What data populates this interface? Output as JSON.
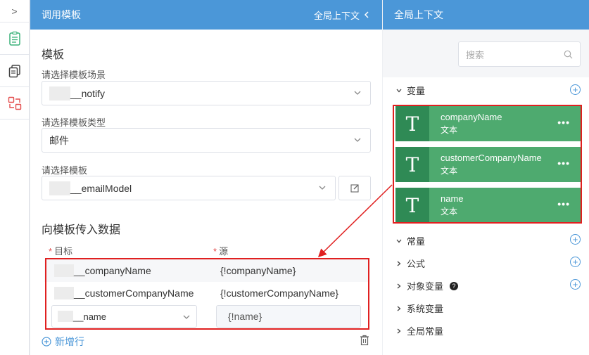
{
  "rail": {
    "toggle": ">"
  },
  "middle": {
    "header_title": "调用模板",
    "header_ctx": "全局上下文",
    "section_template": "模板",
    "scene": {
      "label": "请选择模板场景",
      "value": "__notify"
    },
    "type": {
      "label": "请选择模板类型",
      "value": "邮件"
    },
    "template": {
      "label": "请选择模板",
      "value": "__emailModel"
    },
    "section_pass": "向模板传入数据",
    "col_target": "目标",
    "col_source": "源",
    "required_mark": "*",
    "rows": [
      {
        "target": "__companyName",
        "source": "{!companyName}"
      },
      {
        "target": "__customerCompanyName",
        "source": "{!customerCompanyName}"
      },
      {
        "target": "__name",
        "source": "{!name}"
      }
    ],
    "add_row": "新增行"
  },
  "right": {
    "header_title": "全局上下文",
    "search_placeholder": "搜索",
    "group_variables": "变量",
    "variables": [
      {
        "name": "companyName",
        "type": "文本",
        "icon": "T"
      },
      {
        "name": "customerCompanyName",
        "type": "文本",
        "icon": "T"
      },
      {
        "name": "name",
        "type": "文本",
        "icon": "T"
      }
    ],
    "more": "•••",
    "groups": [
      {
        "label": "常量",
        "plus": true
      },
      {
        "label": "公式",
        "plus": true
      },
      {
        "label": "对象变量",
        "plus": true,
        "help": "?"
      },
      {
        "label": "系统变量",
        "plus": false
      },
      {
        "label": "全局常量",
        "plus": false
      }
    ]
  },
  "colors": {
    "header": "#4b97d8",
    "card": "#4eaa6f",
    "card_icon": "#2f8a55",
    "highlight": "#e02020",
    "rail_icon_green": "#3bb27a",
    "rail_icon_red": "#e34d4d"
  }
}
